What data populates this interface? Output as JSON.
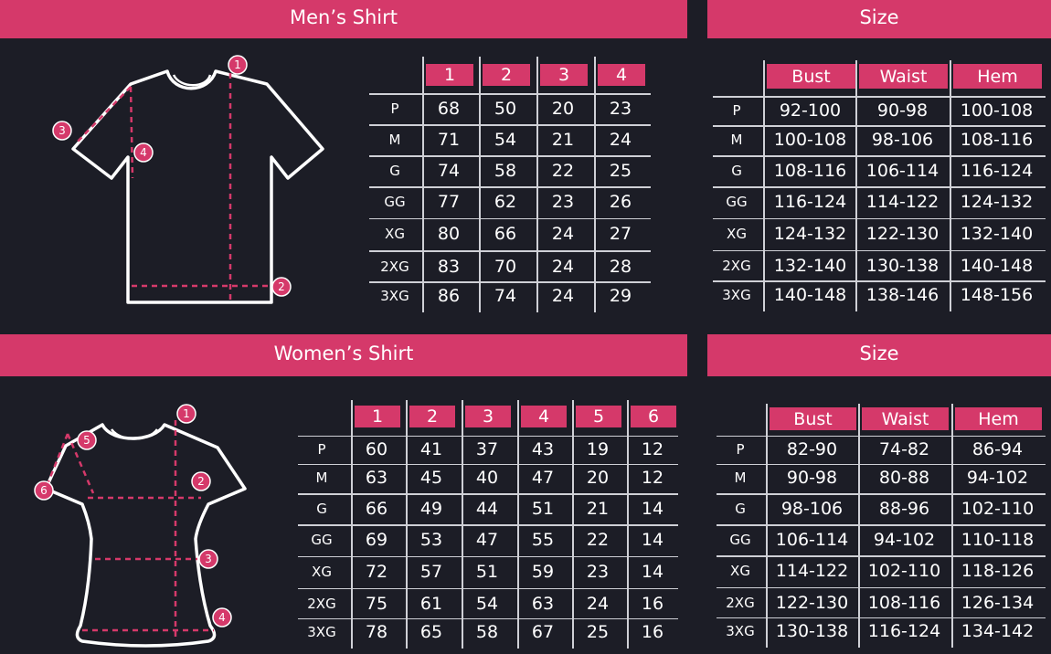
{
  "men": {
    "title": "Men’s Shirt",
    "size_title": "Size",
    "markers": [
      "1",
      "2",
      "3",
      "4"
    ],
    "columns": [
      "1",
      "2",
      "3",
      "4"
    ],
    "rows": [
      "P",
      "M",
      "G",
      "GG",
      "XG",
      "2XG",
      "3XG"
    ],
    "values": [
      [
        "68",
        "50",
        "20",
        "23"
      ],
      [
        "71",
        "54",
        "21",
        "24"
      ],
      [
        "74",
        "58",
        "22",
        "25"
      ],
      [
        "77",
        "62",
        "23",
        "26"
      ],
      [
        "80",
        "66",
        "24",
        "27"
      ],
      [
        "83",
        "70",
        "24",
        "28"
      ],
      [
        "86",
        "74",
        "24",
        "29"
      ]
    ],
    "size_columns": [
      "Bust",
      "Waist",
      "Hem"
    ],
    "size_values": [
      [
        "92-100",
        "90-98",
        "100-108"
      ],
      [
        "100-108",
        "98-106",
        "108-116"
      ],
      [
        "108-116",
        "106-114",
        "116-124"
      ],
      [
        "116-124",
        "114-122",
        "124-132"
      ],
      [
        "124-132",
        "122-130",
        "132-140"
      ],
      [
        "132-140",
        "130-138",
        "140-148"
      ],
      [
        "140-148",
        "138-146",
        "148-156"
      ]
    ]
  },
  "women": {
    "title": "Women’s Shirt",
    "size_title": "Size",
    "markers": [
      "1",
      "2",
      "3",
      "4",
      "5",
      "6"
    ],
    "columns": [
      "1",
      "2",
      "3",
      "4",
      "5",
      "6"
    ],
    "rows": [
      "P",
      "M",
      "G",
      "GG",
      "XG",
      "2XG",
      "3XG"
    ],
    "values": [
      [
        "60",
        "41",
        "37",
        "43",
        "19",
        "12"
      ],
      [
        "63",
        "45",
        "40",
        "47",
        "20",
        "12"
      ],
      [
        "66",
        "49",
        "44",
        "51",
        "21",
        "14"
      ],
      [
        "69",
        "53",
        "47",
        "55",
        "22",
        "14"
      ],
      [
        "72",
        "57",
        "51",
        "59",
        "23",
        "14"
      ],
      [
        "75",
        "61",
        "54",
        "63",
        "24",
        "16"
      ],
      [
        "78",
        "65",
        "58",
        "67",
        "25",
        "16"
      ]
    ],
    "size_columns": [
      "Bust",
      "Waist",
      "Hem"
    ],
    "size_values": [
      [
        "82-90",
        "74-82",
        "86-94"
      ],
      [
        "90-98",
        "80-88",
        "94-102"
      ],
      [
        "98-106",
        "88-96",
        "102-110"
      ],
      [
        "106-114",
        "94-102",
        "110-118"
      ],
      [
        "114-122",
        "102-110",
        "118-126"
      ],
      [
        "122-130",
        "108-116",
        "126-134"
      ],
      [
        "130-138",
        "116-124",
        "134-142"
      ]
    ]
  },
  "colors": {
    "accent": "#d5396a",
    "background": "#1c1d26",
    "lines": "#cfd0d6",
    "text": "#ffffff"
  }
}
